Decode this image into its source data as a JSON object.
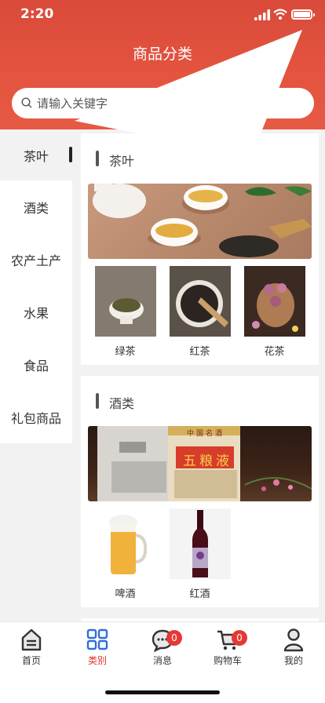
{
  "status": {
    "time": "2:20"
  },
  "header": {
    "title": "商品分类"
  },
  "search": {
    "placeholder": "请输入关键字"
  },
  "sidebar": {
    "items": [
      {
        "label": "茶叶",
        "active": true
      },
      {
        "label": "酒类"
      },
      {
        "label": "农产土产"
      },
      {
        "label": "水果"
      },
      {
        "label": "食品"
      },
      {
        "label": "礼包商品"
      }
    ]
  },
  "sections": [
    {
      "title": "茶叶",
      "items": [
        {
          "label": "绿茶"
        },
        {
          "label": "红茶"
        },
        {
          "label": "花茶"
        }
      ]
    },
    {
      "title": "酒类",
      "banner_text": "五粮液",
      "banner_badge": "中国名酒",
      "items": [
        {
          "label": "啤酒"
        },
        {
          "label": "红酒"
        }
      ]
    }
  ],
  "tabbar": {
    "items": [
      {
        "label": "首页"
      },
      {
        "label": "类别",
        "active": true
      },
      {
        "label": "消息",
        "badge": "0"
      },
      {
        "label": "购物车",
        "badge": "0"
      },
      {
        "label": "我的"
      }
    ]
  },
  "colors": {
    "accent": "#e4543f",
    "active_tab": "#d9372d",
    "badge": "#e53935"
  }
}
